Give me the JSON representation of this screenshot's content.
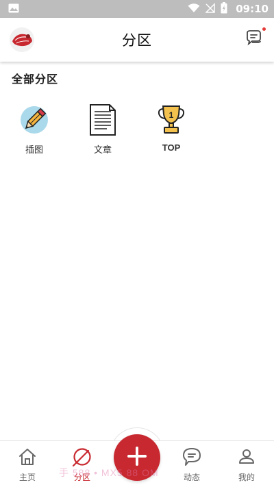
{
  "status_bar": {
    "time": "09:10",
    "icons": [
      "image-icon",
      "wifi-icon",
      "no-sim-icon",
      "battery-charging-icon"
    ],
    "background": "#bdbdbd"
  },
  "header": {
    "title": "分区",
    "avatar_icon": "avatar",
    "message_icon": "message-icon",
    "has_unread_dot": true
  },
  "section": {
    "title": "全部分区",
    "items": [
      {
        "label": "插图",
        "icon": "pencil-icon"
      },
      {
        "label": "文章",
        "icon": "document-icon"
      },
      {
        "label": "TOP",
        "icon": "trophy-icon"
      }
    ]
  },
  "bottom_nav": {
    "items": [
      {
        "label": "主页",
        "icon": "home-icon",
        "active": false
      },
      {
        "label": "分区",
        "icon": "leaf-icon",
        "active": true
      },
      {
        "label": "动态",
        "icon": "chat-bubble-icon",
        "active": false
      },
      {
        "label": "我的",
        "icon": "person-icon",
        "active": false
      }
    ],
    "fab_icon": "plus-icon"
  },
  "watermark": "手 588 • MX5 88 OM",
  "colors": {
    "accent": "#c8282f",
    "nav_inactive": "#666666"
  }
}
